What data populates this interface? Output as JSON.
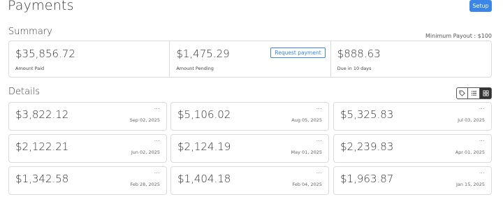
{
  "header": {
    "title": "Payments",
    "setup_label": "Setup"
  },
  "summary": {
    "title": "Summary",
    "min_payout": "Minimum Payout : $100",
    "cells": [
      {
        "amount": "$35,856.72",
        "label": "Amount Paid"
      },
      {
        "amount": "$1,475.29",
        "label": "Amount Pending",
        "action_label": "Request payment"
      },
      {
        "amount": "$888.63",
        "label": "Due in 10 days"
      }
    ]
  },
  "details": {
    "title": "Details",
    "view_icons": [
      "tag-icon",
      "list-icon",
      "grid-icon"
    ],
    "more_label": "···",
    "items": [
      {
        "amount": "$3,822.12",
        "date": "Sep 02, 2025"
      },
      {
        "amount": "$5,106.02",
        "date": "Aug 05, 2025"
      },
      {
        "amount": "$5,325.83",
        "date": "Jul 03, 2025"
      },
      {
        "amount": "$2,122.21",
        "date": "Jun 02, 2025"
      },
      {
        "amount": "$2,124.19",
        "date": "May 01, 2025"
      },
      {
        "amount": "$2,239.83",
        "date": "Apr 01, 2025"
      },
      {
        "amount": "$1,342.58",
        "date": "Feb 28, 2025"
      },
      {
        "amount": "$1,404.18",
        "date": "Feb 04, 2025"
      },
      {
        "amount": "$1,963.87",
        "date": "Jan 15, 2025"
      }
    ]
  },
  "colors": {
    "accent": "#3a86e8",
    "border": "#dcdcdc",
    "text": "#333333"
  }
}
